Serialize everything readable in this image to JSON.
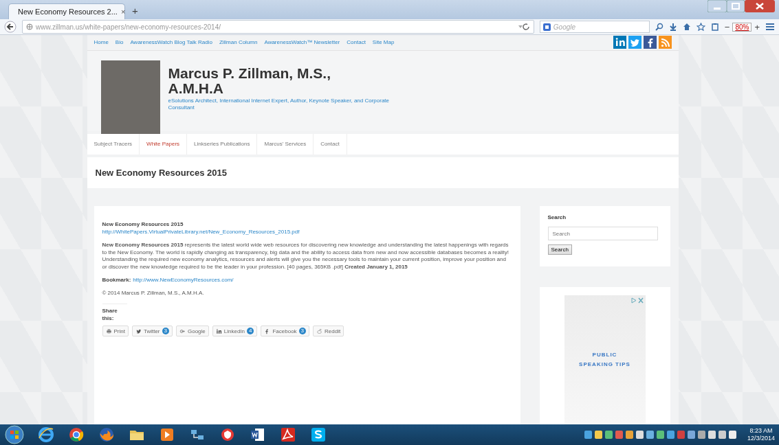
{
  "browser": {
    "tab_title": "New Economy Resources 2...",
    "tab_close": "×",
    "new_tab": "+",
    "url": "www.zillman.us/white-papers/new-economy-resources-2014/",
    "search_placeholder": "Google",
    "zoom": "80%",
    "zoom_out": "−",
    "zoom_in": "+"
  },
  "site": {
    "breadcrumbs": [
      "Home",
      "Bio",
      "AwarenessWatch Blog Talk Radio",
      "Zillman Column",
      "AwarenessWatch™ Newsletter",
      "Contact",
      "Site Map"
    ],
    "social": [
      {
        "kind": "linkedin"
      },
      {
        "kind": "twitter"
      },
      {
        "kind": "facebook"
      },
      {
        "kind": "rss"
      }
    ],
    "name": "Marcus P. Zillman, M.S., A.M.H.A",
    "tagline": "eSolutions Architect, International Internet Expert, Author, Keynote Speaker, and Corporate Consultant",
    "nav": [
      {
        "label": "Subject Tracers",
        "selected": false
      },
      {
        "label": "White Papers",
        "selected": true
      },
      {
        "label": "Linkseries Publications",
        "selected": false
      },
      {
        "label": "Marcus' Services",
        "selected": false
      },
      {
        "label": "Contact",
        "selected": false
      }
    ],
    "page_title": "New Economy Resources 2015",
    "article": {
      "heading": "New Economy Resources 2015",
      "link": "http://WhitePapers.VirtualPrivateLibrary.net/New_Economy_Resources_2015.pdf",
      "body": "**New Economy Resources 2015** represents the latest world wide web resources for discovering new knowledge and understanding the latest happenings with regards to the New Economy. The world is rapidly changing as transparency, big data and the ability to access data from new and now accessible databases becomes a reality! Understanding the required new economy analytics, resources and alerts will give you the necessary tools to maintain your current position, improve your position and or discover the new knowledge required to be the leader in your profession. [40 pages, 365KB .pdf] **Created January 1, 2015**",
      "bookmark_label": "Bookmark:",
      "bookmark_url": "http://www.NewEconomyResources.com/",
      "copyright": "© 2014 Marcus P. Zillman, M.S., A.M.H.A.",
      "share_title": "Share this:",
      "share": [
        {
          "kind": "print",
          "label": "Print"
        },
        {
          "kind": "twitter",
          "label": "Twitter",
          "count": "3"
        },
        {
          "kind": "google",
          "label": "Google"
        },
        {
          "kind": "linkedin",
          "label": "LinkedIn",
          "count": "4"
        },
        {
          "kind": "facebook",
          "label": "Facebook",
          "count": "3"
        },
        {
          "kind": "reddit",
          "label": "Reddit"
        }
      ]
    },
    "sidebar": {
      "search_title": "Search",
      "search_placeholder": "Search",
      "search_button": "Search",
      "ad_lines": [
        "PUBLIC",
        "SPEAKING TIPS"
      ]
    }
  },
  "taskbar": {
    "apps": [
      {
        "kind": "ie"
      },
      {
        "kind": "chrome"
      },
      {
        "kind": "firefox"
      },
      {
        "kind": "folder"
      },
      {
        "kind": "media"
      },
      {
        "kind": "network"
      },
      {
        "kind": "shield"
      },
      {
        "kind": "word"
      },
      {
        "kind": "acrobat"
      },
      {
        "kind": "skype"
      }
    ],
    "time": "8:23 AM",
    "date": "12/3/2014"
  }
}
